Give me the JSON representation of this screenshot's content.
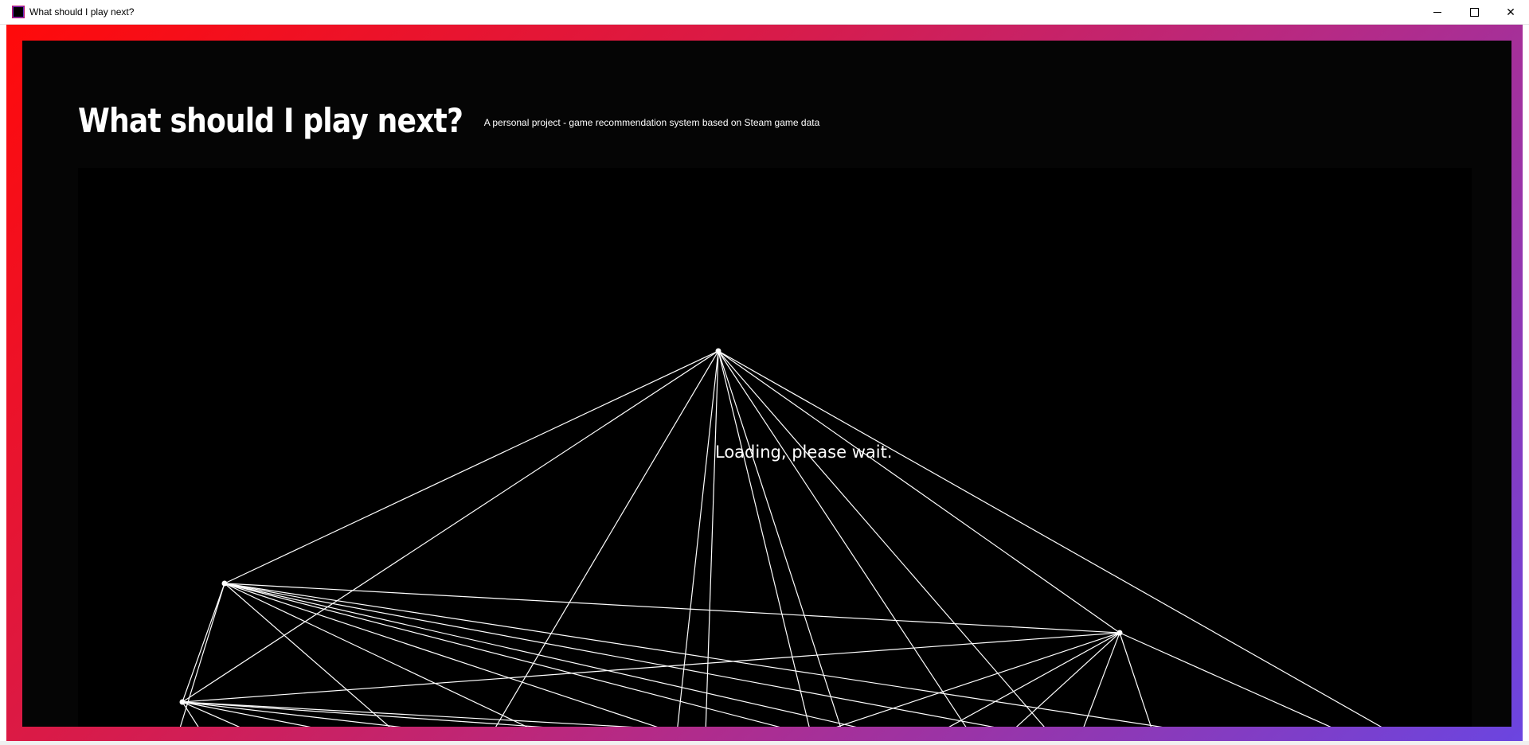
{
  "window": {
    "title": "What should I play next?",
    "icon": "app-icon",
    "controls": [
      "minimize-icon",
      "maximize-icon",
      "close-icon"
    ],
    "close_glyph": "✕"
  },
  "page": {
    "heading": "What should I play next?",
    "subtitle": "A personal project - game recommendation system based on Steam game data",
    "loading_text": "Loading, please wait."
  },
  "colors": {
    "frame_gradient": [
      "#ff0a0a",
      "#d81b4a",
      "#b52a86",
      "#6b45e0"
    ],
    "background": "#000000",
    "foreground": "#ffffff"
  }
}
